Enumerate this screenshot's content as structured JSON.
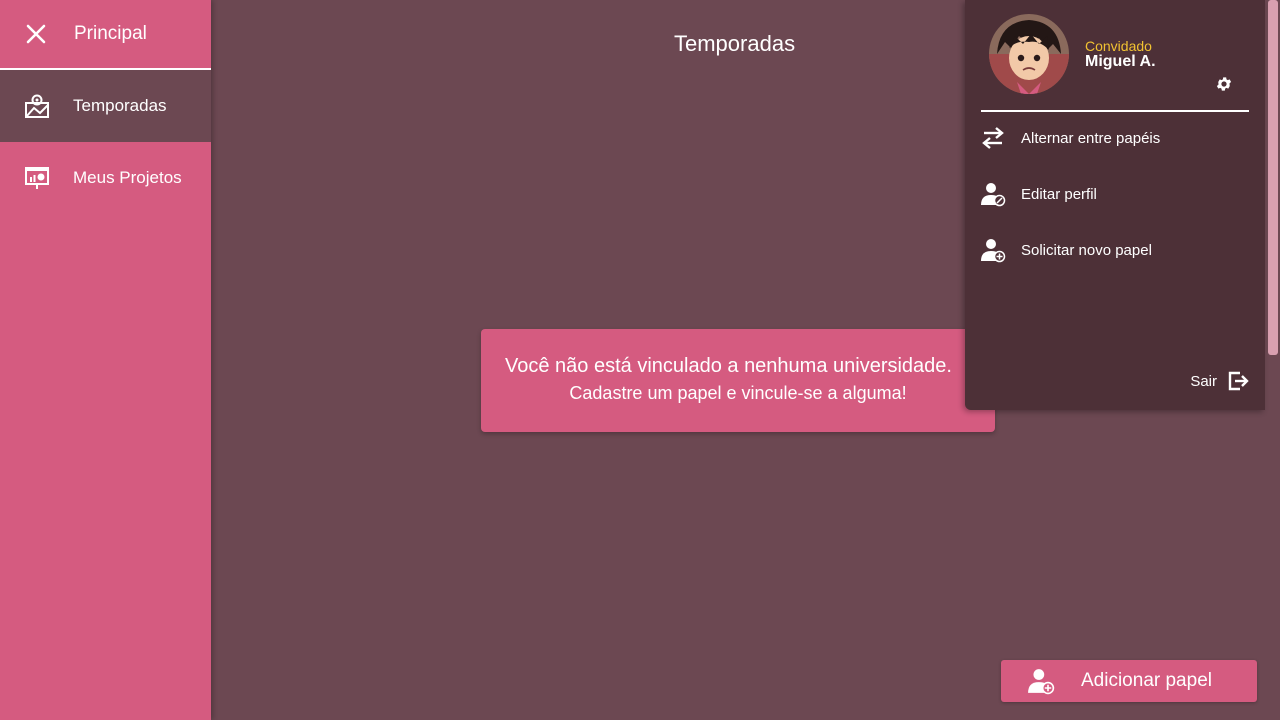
{
  "sidebar": {
    "title": "Principal",
    "items": [
      {
        "label": "Temporadas",
        "icon": "seasons-map-icon",
        "active": true
      },
      {
        "label": "Meus Projetos",
        "icon": "projects-presentation-icon",
        "active": false
      }
    ]
  },
  "main": {
    "title": "Temporadas",
    "notice": {
      "line1": "Você não está vinculado a nenhuma universidade.",
      "line2": "Cadastre um papel e vincule-se a alguma!"
    }
  },
  "profile": {
    "role": "Convidado",
    "name": "Miguel A.",
    "menu": [
      {
        "label": "Alternar entre papéis",
        "icon": "swap-arrows-icon"
      },
      {
        "label": "Editar perfil",
        "icon": "user-edit-icon"
      },
      {
        "label": "Solicitar novo papel",
        "icon": "user-add-icon"
      }
    ],
    "logout_label": "Sair"
  },
  "actions": {
    "add_role_label": "Adicionar papel"
  },
  "colors": {
    "accent": "#d55b80",
    "background": "#6c4852",
    "panel": "#4d3037",
    "role_text": "#f1c232"
  }
}
